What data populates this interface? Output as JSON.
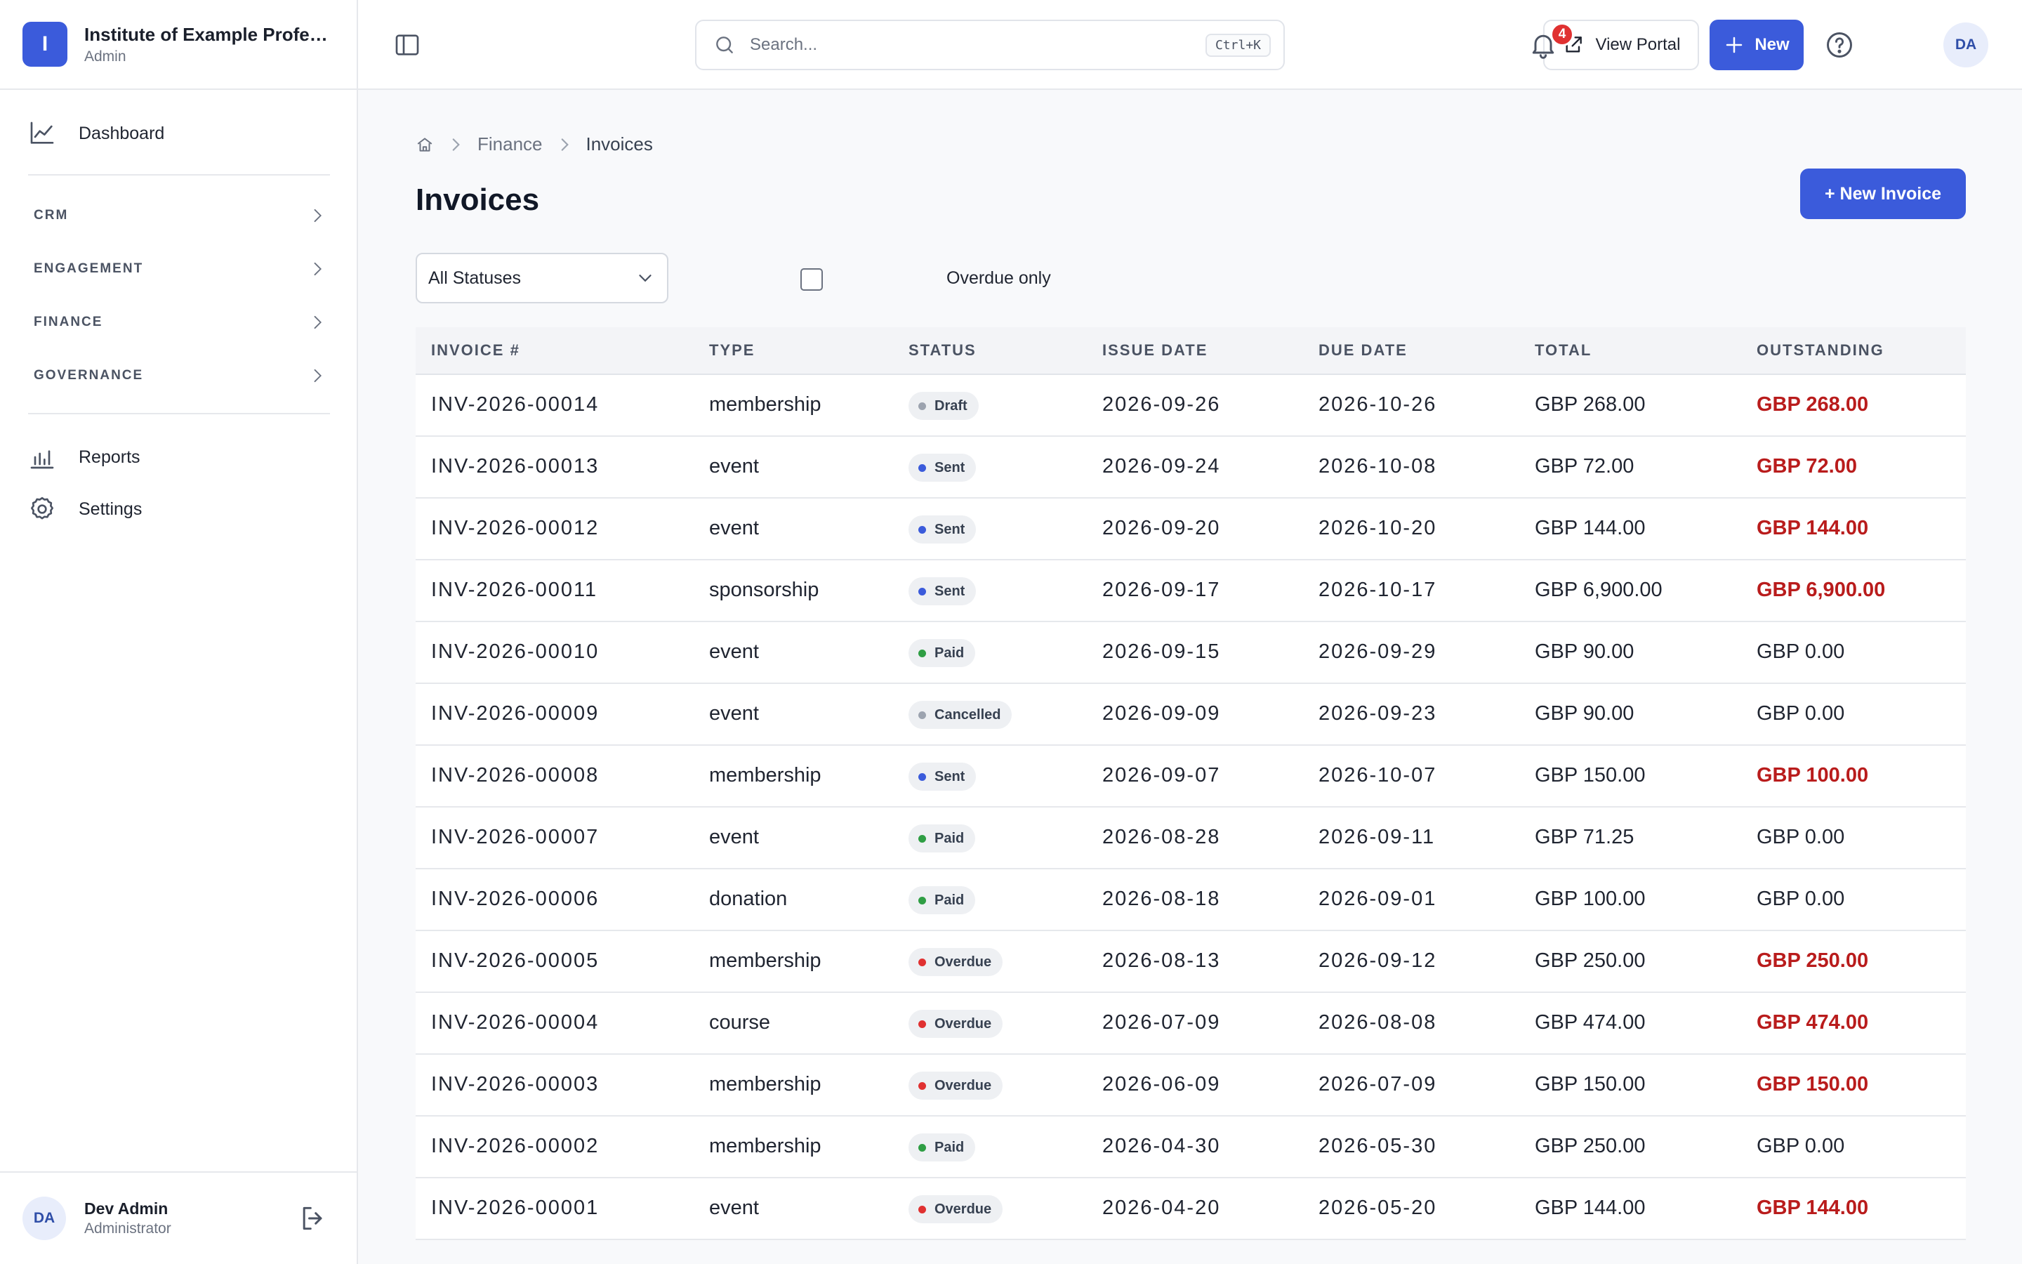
{
  "brand": {
    "logo_letter": "I",
    "name": "Institute of Example Professionals",
    "role": "Admin"
  },
  "sidebar": {
    "dashboard": {
      "label": "Dashboard",
      "icon": "chart-line-icon"
    },
    "groups": [
      {
        "label": "CRM"
      },
      {
        "label": "ENGAGEMENT"
      },
      {
        "label": "FINANCE"
      },
      {
        "label": "GOVERNANCE"
      }
    ],
    "reports": {
      "label": "Reports",
      "icon": "bar-chart-icon"
    },
    "settings": {
      "label": "Settings",
      "icon": "gear-icon"
    },
    "user": {
      "initials": "DA",
      "name": "Dev Admin",
      "role": "Administrator"
    }
  },
  "topbar": {
    "search_placeholder": "Search...",
    "search_shortcut": "Ctrl+K",
    "view_portal_label": "View Portal",
    "new_label": "New",
    "notification_count": "4",
    "avatar_initials": "DA"
  },
  "breadcrumb": {
    "items": [
      "Finance",
      "Invoices"
    ]
  },
  "page": {
    "title": "Invoices",
    "new_invoice_label": "+ New Invoice"
  },
  "filters": {
    "status_selected": "All Statuses",
    "overdue_only_label": "Overdue only",
    "overdue_only_checked": false
  },
  "table": {
    "columns": [
      "INVOICE #",
      "TYPE",
      "STATUS",
      "ISSUE DATE",
      "DUE DATE",
      "TOTAL",
      "OUTSTANDING"
    ],
    "rows": [
      {
        "invoice": "INV-2026-00014",
        "type": "membership",
        "status": "Draft",
        "issue": "2026-09-26",
        "due": "2026-10-26",
        "total": "GBP 268.00",
        "outstanding": "GBP 268.00"
      },
      {
        "invoice": "INV-2026-00013",
        "type": "event",
        "status": "Sent",
        "issue": "2026-09-24",
        "due": "2026-10-08",
        "total": "GBP 72.00",
        "outstanding": "GBP 72.00"
      },
      {
        "invoice": "INV-2026-00012",
        "type": "event",
        "status": "Sent",
        "issue": "2026-09-20",
        "due": "2026-10-20",
        "total": "GBP 144.00",
        "outstanding": "GBP 144.00"
      },
      {
        "invoice": "INV-2026-00011",
        "type": "sponsorship",
        "status": "Sent",
        "issue": "2026-09-17",
        "due": "2026-10-17",
        "total": "GBP 6,900.00",
        "outstanding": "GBP 6,900.00"
      },
      {
        "invoice": "INV-2026-00010",
        "type": "event",
        "status": "Paid",
        "issue": "2026-09-15",
        "due": "2026-09-29",
        "total": "GBP 90.00",
        "outstanding": "GBP 0.00"
      },
      {
        "invoice": "INV-2026-00009",
        "type": "event",
        "status": "Cancelled",
        "issue": "2026-09-09",
        "due": "2026-09-23",
        "total": "GBP 90.00",
        "outstanding": "GBP 0.00"
      },
      {
        "invoice": "INV-2026-00008",
        "type": "membership",
        "status": "Sent",
        "issue": "2026-09-07",
        "due": "2026-10-07",
        "total": "GBP 150.00",
        "outstanding": "GBP 100.00"
      },
      {
        "invoice": "INV-2026-00007",
        "type": "event",
        "status": "Paid",
        "issue": "2026-08-28",
        "due": "2026-09-11",
        "total": "GBP 71.25",
        "outstanding": "GBP 0.00"
      },
      {
        "invoice": "INV-2026-00006",
        "type": "donation",
        "status": "Paid",
        "issue": "2026-08-18",
        "due": "2026-09-01",
        "total": "GBP 100.00",
        "outstanding": "GBP 0.00"
      },
      {
        "invoice": "INV-2026-00005",
        "type": "membership",
        "status": "Overdue",
        "issue": "2026-08-13",
        "due": "2026-09-12",
        "total": "GBP 250.00",
        "outstanding": "GBP 250.00"
      },
      {
        "invoice": "INV-2026-00004",
        "type": "course",
        "status": "Overdue",
        "issue": "2026-07-09",
        "due": "2026-08-08",
        "total": "GBP 474.00",
        "outstanding": "GBP 474.00"
      },
      {
        "invoice": "INV-2026-00003",
        "type": "membership",
        "status": "Overdue",
        "issue": "2026-06-09",
        "due": "2026-07-09",
        "total": "GBP 150.00",
        "outstanding": "GBP 150.00"
      },
      {
        "invoice": "INV-2026-00002",
        "type": "membership",
        "status": "Paid",
        "issue": "2026-04-30",
        "due": "2026-05-30",
        "total": "GBP 250.00",
        "outstanding": "GBP 0.00"
      },
      {
        "invoice": "INV-2026-00001",
        "type": "event",
        "status": "Overdue",
        "issue": "2026-04-20",
        "due": "2026-05-20",
        "total": "GBP 144.00",
        "outstanding": "GBP 144.00"
      }
    ]
  },
  "status_colors": {
    "Draft": "#9ca3af",
    "Sent": "#3b5bdb",
    "Paid": "#2f9e44",
    "Cancelled": "#9ca3af",
    "Overdue": "#e03131"
  },
  "colors": {
    "accent": "#3b5bdb",
    "outstanding_due": "#b91c1c"
  }
}
